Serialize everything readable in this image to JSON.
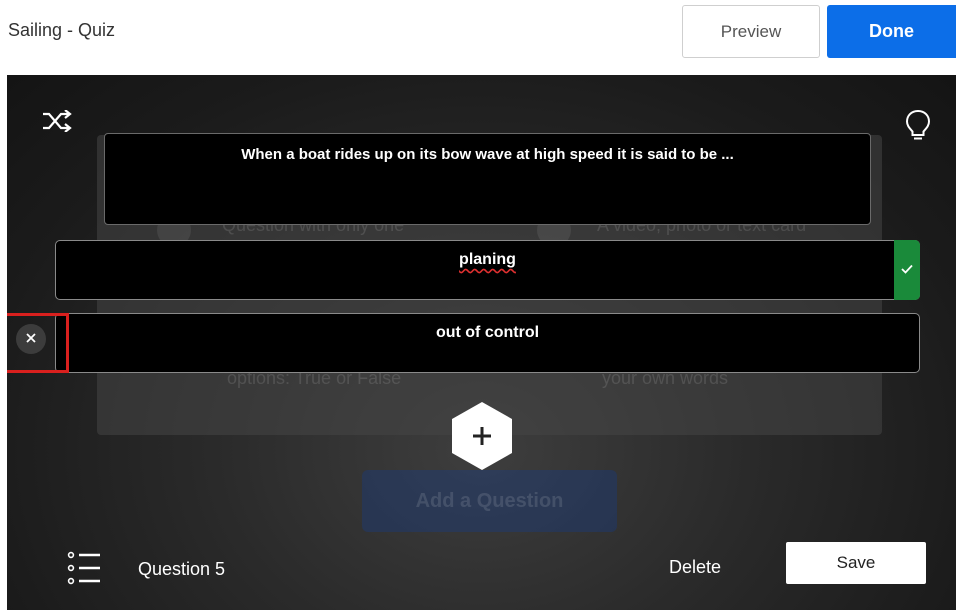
{
  "header": {
    "title": "Sailing - Quiz",
    "preview_label": "Preview",
    "done_label": "Done"
  },
  "editor": {
    "question_text": "When a boat rides up on its bow wave at high speed it is said to be ...",
    "answers": [
      {
        "text": "planing",
        "correct": true
      },
      {
        "text": "out of control",
        "correct": false
      }
    ]
  },
  "background_ghost": {
    "text_1": "Question with only one",
    "text_2": "A video, photo or text card",
    "text_3": "options: True or False",
    "text_4": "your own words",
    "add_question": "Add a Question"
  },
  "footer": {
    "question_label": "Question 5",
    "delete_label": "Delete",
    "save_label": "Save"
  },
  "icons": {
    "shuffle": "shuffle-icon",
    "hint": "lightbulb-icon",
    "check": "checkmark-icon",
    "remove": "close-icon",
    "add": "plus-icon",
    "list": "list-icon"
  },
  "colors": {
    "accent": "#0c6ee8",
    "correct": "#1a8a3a",
    "highlight": "#d9201e"
  }
}
